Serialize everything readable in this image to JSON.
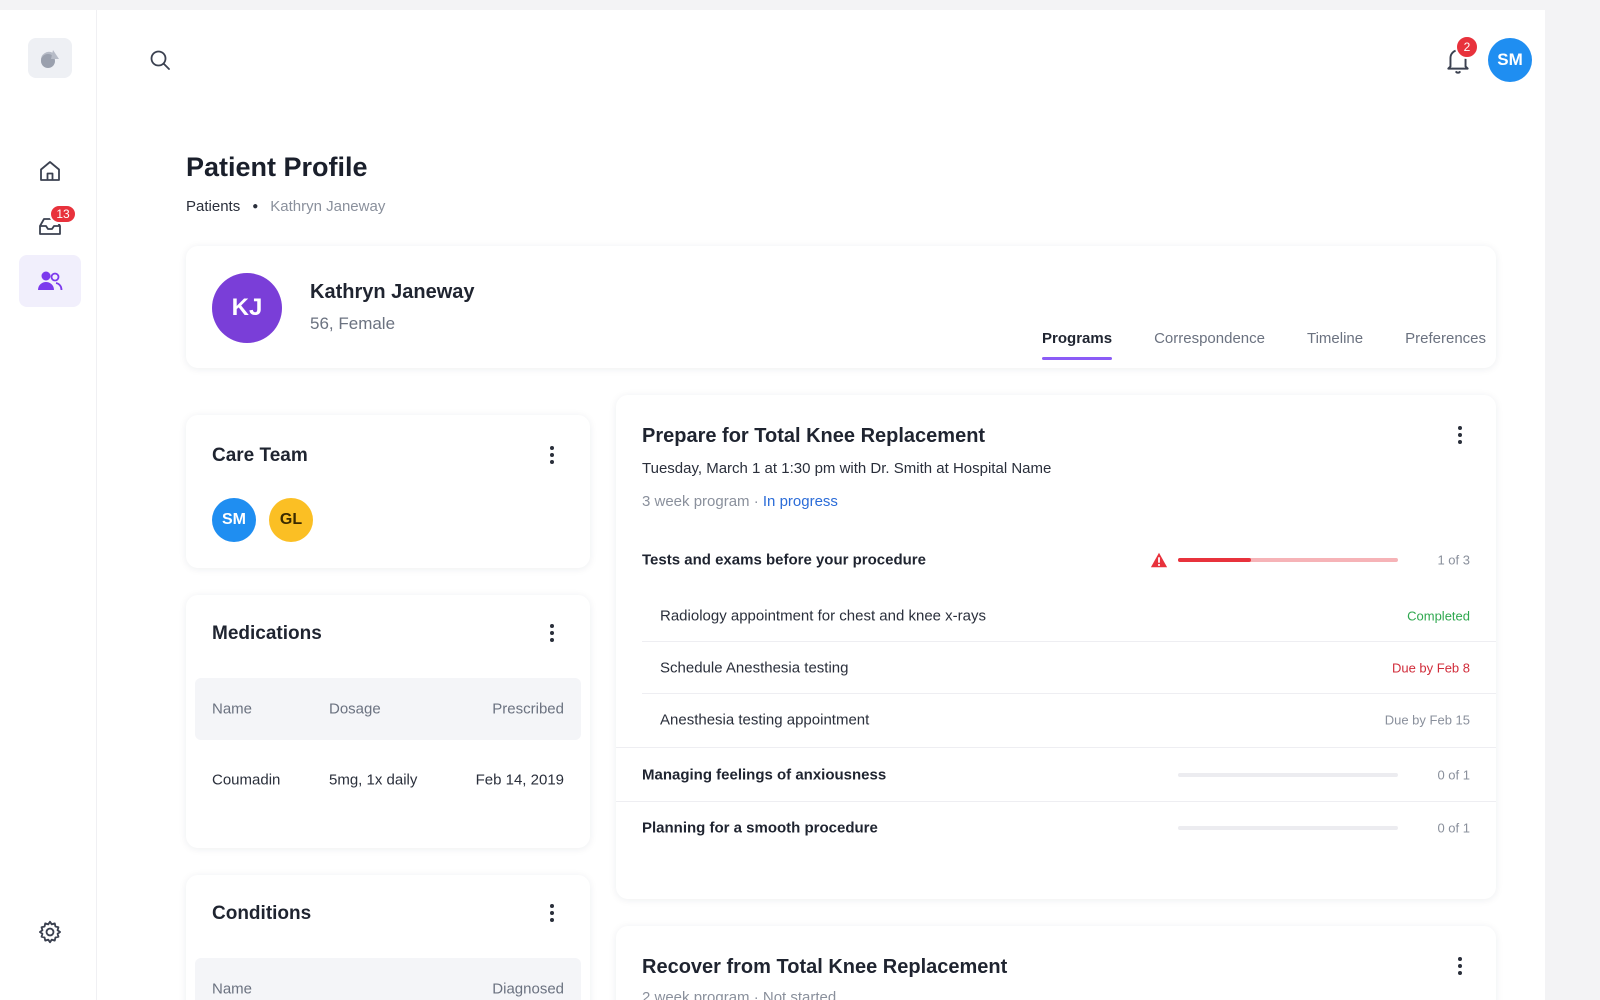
{
  "sidebar": {
    "inbox_badge": "13"
  },
  "topbar": {
    "notification_count": "2",
    "user_initials": "SM"
  },
  "page": {
    "title": "Patient Profile",
    "breadcrumb": [
      "Patients",
      "Kathryn Janeway"
    ]
  },
  "patient": {
    "initials": "KJ",
    "name": "Kathryn Janeway",
    "meta": "56, Female"
  },
  "tabs": [
    {
      "label": "Programs",
      "active": true
    },
    {
      "label": "Correspondence",
      "active": false
    },
    {
      "label": "Timeline",
      "active": false
    },
    {
      "label": "Preferences",
      "active": false
    }
  ],
  "care_team": {
    "title": "Care Team",
    "members": [
      {
        "initials": "SM",
        "color": "#1f8ef1"
      },
      {
        "initials": "GL",
        "color": "#fbbf24"
      }
    ]
  },
  "medications": {
    "title": "Medications",
    "columns": [
      "Name",
      "Dosage",
      "Prescribed"
    ],
    "rows": [
      {
        "name": "Coumadin",
        "dosage": "5mg, 1x daily",
        "prescribed": "Feb 14, 2019"
      }
    ]
  },
  "conditions": {
    "title": "Conditions",
    "columns": [
      "Name",
      "Diagnosed"
    ]
  },
  "program": {
    "title": "Prepare for Total Knee Replacement",
    "subtitle": "Tuesday, March 1 at 1:30 pm with Dr. Smith at Hospital Name",
    "duration": "3 week program · ",
    "status": "In progress",
    "sections": [
      {
        "label": "Tests and exams before your procedure",
        "count": "1 of 3",
        "progress": 0.33,
        "warning": true,
        "tasks": [
          {
            "label": "Radiology appointment for chest and knee x-rays",
            "status": "Completed",
            "status_color": "#2fa84f"
          },
          {
            "label": "Schedule Anesthesia testing",
            "status": "Due by Feb 8",
            "status_color": "#d12c3a"
          },
          {
            "label": "Anesthesia testing appointment",
            "status": "Due by Feb 15",
            "status_color": "#8a909c"
          }
        ]
      },
      {
        "label": "Managing feelings of anxiousness",
        "count": "0 of 1",
        "progress": 0
      },
      {
        "label": "Planning for a smooth procedure",
        "count": "0 of 1",
        "progress": 0
      }
    ]
  },
  "program2": {
    "title": "Recover from Total Knee Replacement",
    "status_line": "2 week program · Not started"
  },
  "colors": {
    "accent": "#8b5cf6",
    "badge": "#e8323c",
    "progress_warn": "#e8323c",
    "progress_warn_track": "#f6b3b7"
  }
}
